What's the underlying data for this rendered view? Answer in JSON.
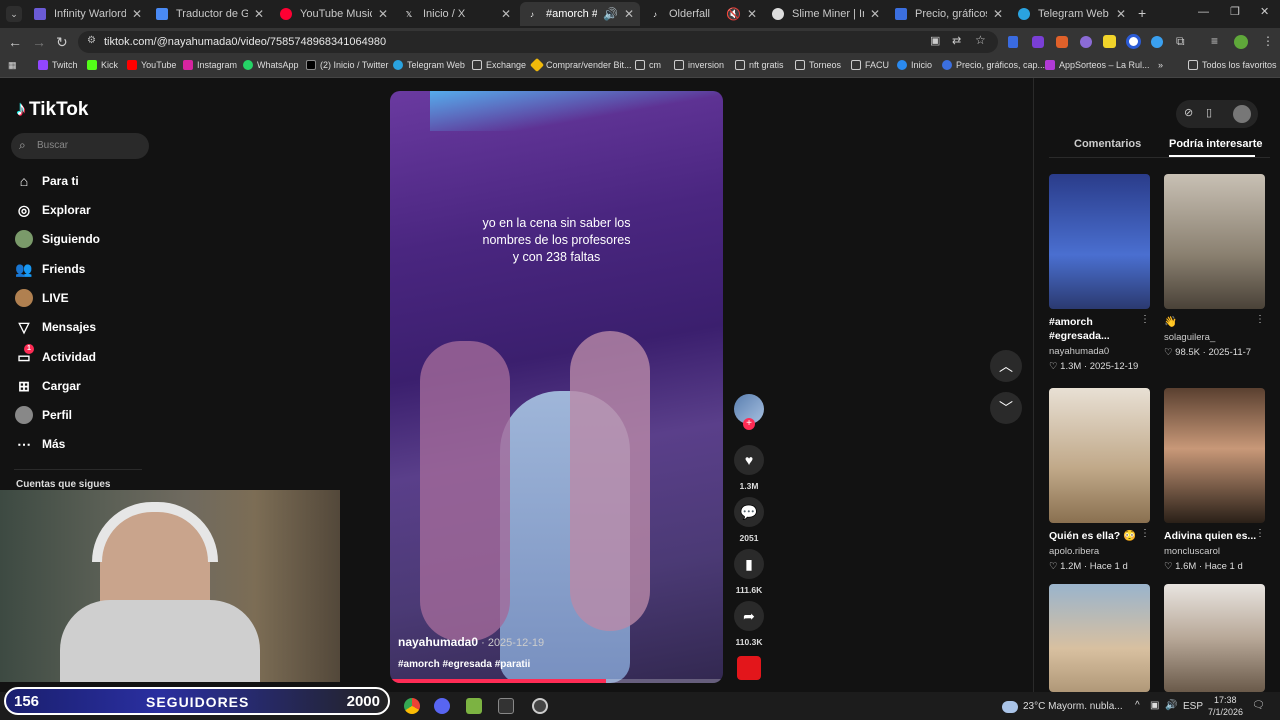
{
  "browser": {
    "tabs": [
      {
        "label": "Infinity Warlords",
        "color": "#6b5bd6"
      },
      {
        "label": "Traductor de Google",
        "color": "#4a8af4"
      },
      {
        "label": "YouTube Music",
        "color": "#ff0033"
      },
      {
        "label": "Inicio / X",
        "color": "#000000"
      },
      {
        "label": "#amorch #egresa",
        "color": "#111111"
      },
      {
        "label": "Olderfall",
        "color": "#222222"
      },
      {
        "label": "Slime Miner | Immuta",
        "color": "#dddddd"
      },
      {
        "label": "Precio, gráficos, capi",
        "color": "#3b6fe0"
      },
      {
        "label": "Telegram Web",
        "color": "#2aa3e0"
      }
    ],
    "url": "tiktok.com/@nayahumada0/video/7585748968341064980",
    "bookmarks": [
      "Twitch",
      "Kick",
      "YouTube",
      "Instagram",
      "WhatsApp",
      "(2) Inicio / Twitter",
      "Telegram Web",
      "Exchange",
      "Comprar/vender Bit...",
      "cm",
      "inversion",
      "nft gratis",
      "Torneos",
      "FACU",
      "Inicio",
      "Precio, gráficos, cap...",
      "AppSorteos – La Rul..."
    ],
    "bookmarks_all": "Todos los favoritos"
  },
  "tiktok": {
    "logo": "TikTok",
    "search_placeholder": "Buscar",
    "nav": [
      {
        "label": "Para ti",
        "icon": "home-icon"
      },
      {
        "label": "Explorar",
        "icon": "compass-icon"
      },
      {
        "label": "Siguiendo",
        "icon": "avatar-icon"
      },
      {
        "label": "Friends",
        "icon": "friends-icon"
      },
      {
        "label": "LIVE",
        "icon": "live-icon"
      },
      {
        "label": "Mensajes",
        "icon": "message-icon"
      },
      {
        "label": "Actividad",
        "icon": "activity-icon"
      },
      {
        "label": "Cargar",
        "icon": "upload-icon"
      },
      {
        "label": "Perfil",
        "icon": "profile-icon"
      },
      {
        "label": "Más",
        "icon": "more-icon"
      }
    ],
    "activity_badge": "1",
    "following_heading": "Cuentas que sigues",
    "video": {
      "caption": [
        "yo en la cena sin saber los",
        "nombres de los profesores",
        "y con 238 faltas"
      ],
      "user": "nayahumada0",
      "date": " · 2025-12-19",
      "tags": "#amorch #egresada #paratii"
    },
    "actions": {
      "likes": "1.3M",
      "comments": "2051",
      "saves": "111.6K",
      "shares": "110.3K"
    },
    "panel": {
      "tab_comments": "Comentarios",
      "tab_suggested": "Podría interesarte",
      "cards": [
        {
          "title": "#amorch #egresada...",
          "user": "nayahumada0",
          "likes": "1.3M",
          "when": "2025-12-19",
          "color": "#3a5fc0"
        },
        {
          "title": "👋",
          "user": "solaguilera_",
          "likes": "98.5K",
          "when": "2025-11-7",
          "color": "#9a8f80"
        },
        {
          "title": "Quién es ella? 😳",
          "user": "apolo.ribera",
          "likes": "1.2M",
          "when": "Hace 1 d",
          "color": "#c9b49a"
        },
        {
          "title": "Adivina quien es...",
          "user": "moncluscarol",
          "likes": "1.6M",
          "when": "Hace 1 d",
          "color": "#6e5a44"
        },
        {
          "title": "",
          "user": "",
          "likes": "",
          "when": "",
          "color": "#8aa0b8"
        },
        {
          "title": "",
          "user": "",
          "likes": "",
          "when": "",
          "color": "#b7a99a"
        }
      ]
    }
  },
  "overlay": {
    "followers_current": "156",
    "followers_label": "SEGUIDORES",
    "followers_goal": "2000"
  },
  "taskbar": {
    "weather": "23°C  Mayorm. nubla...",
    "lang": "ESP",
    "time": "17:38",
    "date": "7/1/2026"
  }
}
